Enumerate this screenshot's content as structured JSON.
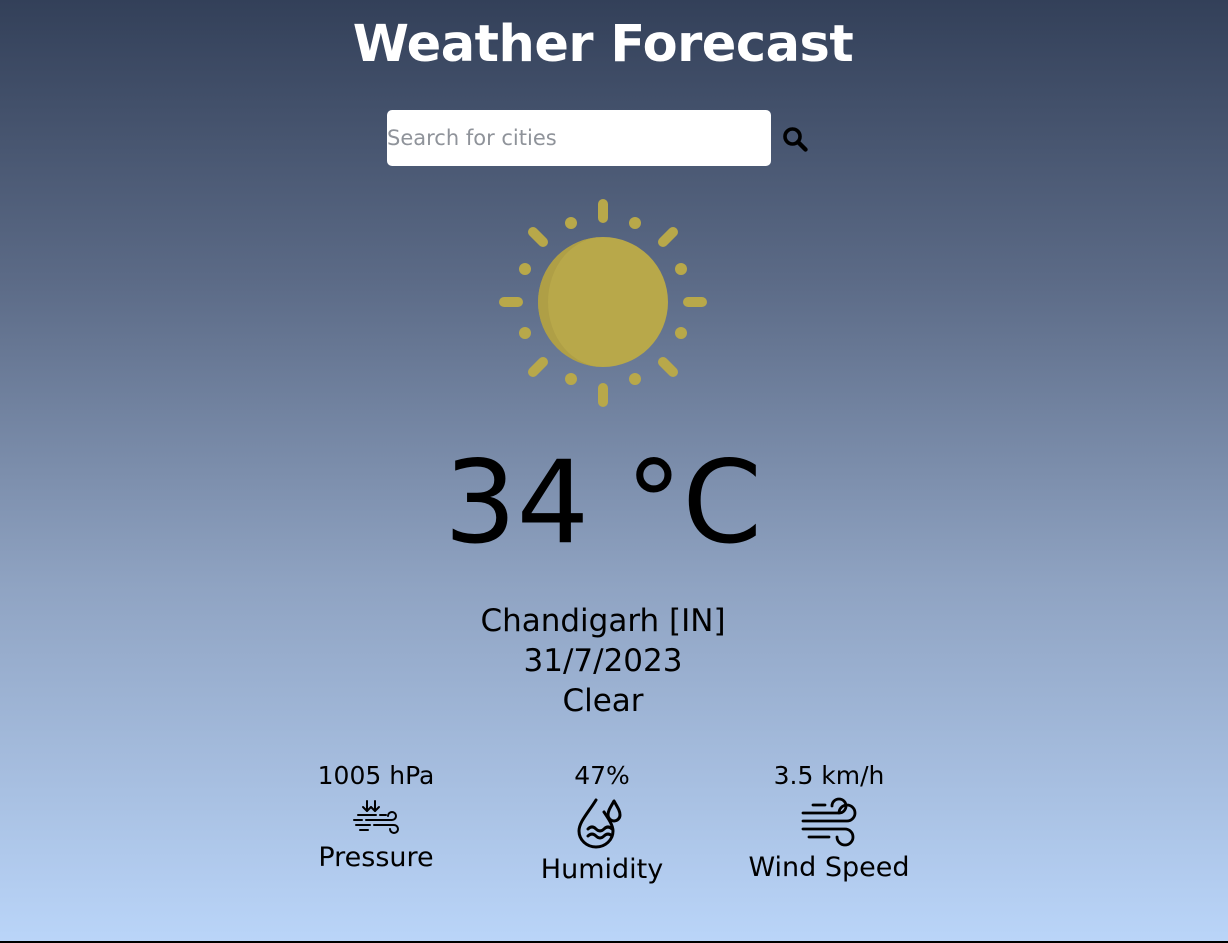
{
  "header": {
    "title": "Weather Forecast"
  },
  "search": {
    "placeholder": "Search for cities",
    "value": ""
  },
  "icons": {
    "search": "search-icon",
    "weather": "sun-icon",
    "pressure": "pressure-icon",
    "humidity": "humidity-icon",
    "wind": "wind-icon"
  },
  "colors": {
    "gradient_top": "#334059",
    "gradient_bottom": "#bad5f9",
    "sun": "#b8a84a",
    "title": "#ffffff"
  },
  "current": {
    "temperature": "34 °C",
    "location": "Chandigarh [IN]",
    "date": "31/7/2023",
    "condition": "Clear"
  },
  "stats": {
    "pressure": {
      "value": "1005 hPa",
      "label": "Pressure"
    },
    "humidity": {
      "value": "47%",
      "label": "Humidity"
    },
    "wind": {
      "value": "3.5 km/h",
      "label": "Wind Speed"
    }
  }
}
